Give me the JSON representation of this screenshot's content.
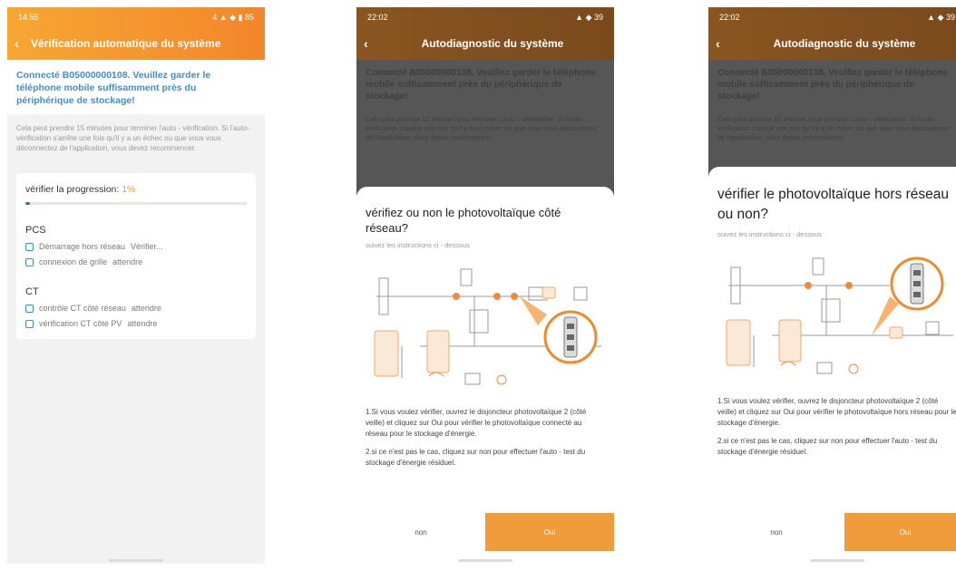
{
  "screen1": {
    "status_time": "14:55",
    "status_icons": "4 ▲ ◆ ▮ 85",
    "title": "Vérification automatique du système",
    "notice": "Connecté B05000000108. Veuillez garder le téléphone mobile suffisamment près du périphérique de stockage!",
    "note": "Cela peut prendre 15 minutes pour terminer l'auto - vérification. Si l'auto-vérification s'arrête une fois qu'il y a un échec ou que vous vous déconnectez de l'application, vous devez recommencer.",
    "progress_label": "vérifier la progression:",
    "progress_value": "1%",
    "progress_fraction": 0.02,
    "sections": [
      {
        "title": "PCS",
        "items": [
          {
            "label": "Démarrage hors réseau",
            "status": "Vérifier..."
          },
          {
            "label": "connexion de grille",
            "status": "attendre"
          }
        ]
      },
      {
        "title": "CT",
        "items": [
          {
            "label": "contrôle CT côté réseau",
            "status": "attendre"
          },
          {
            "label": "vérification CT côté PV",
            "status": "attendre"
          }
        ]
      }
    ]
  },
  "screen2": {
    "status_time": "22:02",
    "status_icons": "▲ ◆ 39",
    "title": "Autodiagnostic du système",
    "question": "vérifiez ou non le photovoltaïque côté réseau?",
    "subtitle": "suivez les instructions ci - dessous",
    "instruction1": "1.Si vous voulez vérifier, ouvrez le disjoncteur photovoltaïque 2 (côté veille) et cliquez sur Oui pour vérifier le photovoltaïque connecté au réseau pour le stockage d'énergie.",
    "instruction2": "2.si ce n'est pas le cas, cliquez sur non pour effectuer l'auto - test du stockage d'énergie résiduel.",
    "btn_no": "non",
    "btn_yes": "Oui"
  },
  "screen3": {
    "status_time": "22:02",
    "status_icons": "▲ ◆ 39",
    "title": "Autodiagnostic du système",
    "question": "vérifier le photovoltaïque hors réseau ou non?",
    "subtitle": "suivez les instructions ci - dessous",
    "instruction1": "1.Si vous voulez vérifier, ouvrez le disjoncteur photovoltaïque 2 (côté veille) et cliquez sur Oui pour vérifier le photovoltaïque hors réseau pour le stockage d'énergie.",
    "instruction2": "2.si ce n'est pas le cas, cliquez sur non pour effectuer l'auto - test du stockage d'énergie résiduel.",
    "btn_no": "non",
    "btn_yes": "Oui"
  },
  "colors": {
    "accent_orange": "#f3862a",
    "link_blue": "#3a8fd6",
    "progress_blue": "#2f6fd6",
    "button_orange": "#f09b3c"
  }
}
